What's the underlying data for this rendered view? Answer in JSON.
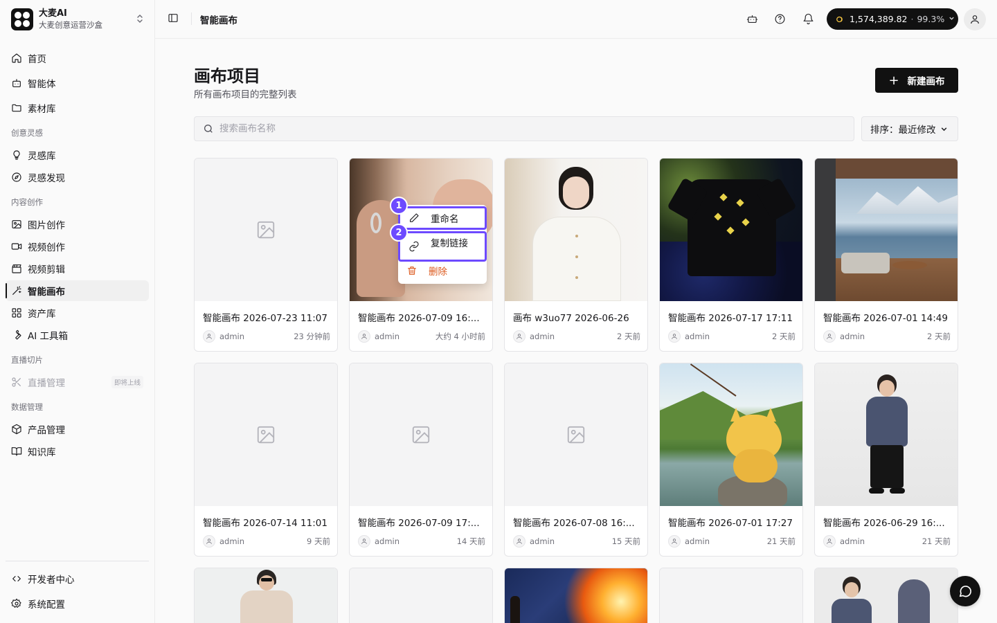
{
  "brand": {
    "title": "大麦AI",
    "subtitle": "大麦创意运营沙盒"
  },
  "sidebar": {
    "items_top": [
      {
        "label": "首页",
        "icon": "home-icon"
      },
      {
        "label": "智能体",
        "icon": "bot-icon"
      },
      {
        "label": "素材库",
        "icon": "folder-icon"
      }
    ],
    "section_inspiration": "创意灵感",
    "items_inspiration": [
      {
        "label": "灵感库",
        "icon": "lightbulb-icon"
      },
      {
        "label": "灵感发现",
        "icon": "compass-icon"
      }
    ],
    "section_content": "内容创作",
    "items_content": [
      {
        "label": "图片创作",
        "icon": "image-icon"
      },
      {
        "label": "视频创作",
        "icon": "video-icon"
      },
      {
        "label": "视频剪辑",
        "icon": "clapperboard-icon"
      },
      {
        "label": "智能画布",
        "icon": "wand-icon",
        "active": true
      },
      {
        "label": "资产库",
        "icon": "grid-icon"
      },
      {
        "label": "AI 工具箱",
        "icon": "wrench-icon"
      }
    ],
    "section_live": "直播切片",
    "items_live": [
      {
        "label": "直播管理",
        "icon": "scissors-icon",
        "disabled": true,
        "badge": "即将上线"
      }
    ],
    "section_data": "数据管理",
    "items_data": [
      {
        "label": "产品管理",
        "icon": "package-icon"
      },
      {
        "label": "知识库",
        "icon": "book-icon"
      }
    ],
    "items_bottom": [
      {
        "label": "开发者中心",
        "icon": "code-icon"
      },
      {
        "label": "系统配置",
        "icon": "settings-icon"
      }
    ]
  },
  "header": {
    "breadcrumb": "智能画布",
    "credits": {
      "amount": "1,574,389.82",
      "separator": "·",
      "percent": "99.3%"
    }
  },
  "main": {
    "title": "画布项目",
    "subtitle": "所有画布项目的完整列表",
    "new_button": "新建画布",
    "search_placeholder": "搜索画布名称",
    "sort_label": "排序：最近修改"
  },
  "context_menu": {
    "items": [
      {
        "label": "重命名",
        "icon": "pencil-icon",
        "step": "1"
      },
      {
        "label": "复制链接",
        "icon": "link-icon",
        "step": "2"
      },
      {
        "label": "删除",
        "icon": "trash-icon"
      }
    ]
  },
  "cards": [
    {
      "title": "智能画布 2026-07-23 11:07",
      "user": "admin",
      "time": "23 分钟前",
      "thumb": "placeholder"
    },
    {
      "title": "智能画布 2026-07-09 16:...",
      "user": "admin",
      "time": "大约 4 小时前",
      "thumb": "earring"
    },
    {
      "title": "画布 w3uo77 2026-06-26",
      "user": "admin",
      "time": "2 天前",
      "thumb": "woman-cardigan"
    },
    {
      "title": "智能画布 2026-07-17 17:11",
      "user": "admin",
      "time": "2 天前",
      "thumb": "black-tshirt"
    },
    {
      "title": "智能画布 2026-07-01 14:49",
      "user": "admin",
      "time": "2 天前",
      "thumb": "terrace-lake"
    },
    {
      "title": "智能画布 2026-07-14 11:01",
      "user": "admin",
      "time": "9 天前",
      "thumb": "placeholder"
    },
    {
      "title": "智能画布 2026-07-09 17:...",
      "user": "admin",
      "time": "14 天前",
      "thumb": "placeholder"
    },
    {
      "title": "智能画布 2026-07-08 16:...",
      "user": "admin",
      "time": "15 天前",
      "thumb": "placeholder"
    },
    {
      "title": "智能画布 2026-07-01 17:27",
      "user": "admin",
      "time": "21 天前",
      "thumb": "fishing-cat"
    },
    {
      "title": "智能画布 2026-06-29 16:...",
      "user": "admin",
      "time": "21 天前",
      "thumb": "boy-hoodie"
    }
  ],
  "colors": {
    "accent": "#6d4aff",
    "danger": "#dc5a1f",
    "primary": "#111111"
  }
}
